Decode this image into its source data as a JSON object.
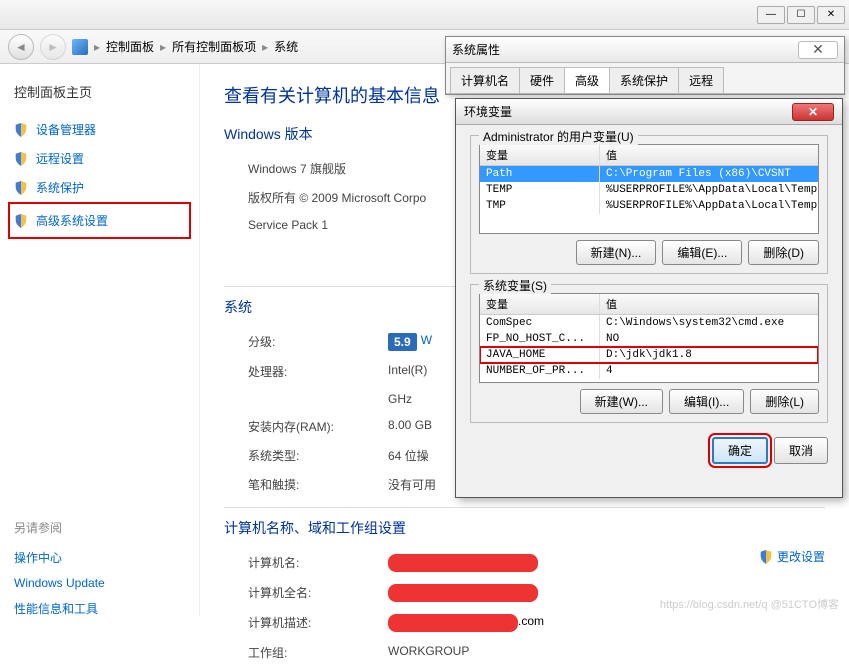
{
  "window": {
    "min": "—",
    "max": "☐",
    "close": "✕"
  },
  "breadcrumb": {
    "icon": "control-panel",
    "seg1": "控制面板",
    "seg2": "所有控制面板项",
    "seg3": "系统"
  },
  "sidebar": {
    "title": "控制面板主页",
    "items": [
      {
        "label": "设备管理器"
      },
      {
        "label": "远程设置"
      },
      {
        "label": "系统保护"
      },
      {
        "label": "高级系统设置"
      }
    ],
    "footer_title": "另请参阅",
    "footer_links": [
      "操作中心",
      "Windows Update",
      "性能信息和工具"
    ]
  },
  "content": {
    "title": "查看有关计算机的基本信息",
    "edition_title": "Windows 版本",
    "edition": "Windows 7 旗舰版",
    "copyright": "版权所有 © 2009 Microsoft Corpo",
    "sp": "Service Pack 1",
    "system_title": "系统",
    "rating_label": "分级:",
    "rating_value": "5.9",
    "rating_link": "W",
    "cpu_label": "处理器:",
    "cpu_value": "Intel(R)",
    "cpu_ghz": "GHz",
    "ram_label": "安装内存(RAM):",
    "ram_value": "8.00 GB",
    "type_label": "系统类型:",
    "type_value": "64 位操",
    "pen_label": "笔和触摸:",
    "pen_value": "没有可用",
    "comp_title": "计算机名称、域和工作组设置",
    "name_label": "计算机名:",
    "fullname_label": "计算机全名:",
    "desc_label": "计算机描述:",
    "desc_value": ".com",
    "workgroup_label": "工作组:",
    "workgroup_value": "WORKGROUP",
    "change_link": "更改设置"
  },
  "sysprops": {
    "title": "系统属性",
    "tabs": [
      "计算机名",
      "硬件",
      "高级",
      "系统保护",
      "远程"
    ]
  },
  "env": {
    "title": "环境变量",
    "user_label": "Administrator 的用户变量(U)",
    "col1": "变量",
    "col2": "值",
    "user_vars": [
      {
        "name": "Path",
        "value": "C:\\Program Files (x86)\\CVSNT"
      },
      {
        "name": "TEMP",
        "value": "%USERPROFILE%\\AppData\\Local\\Temp"
      },
      {
        "name": "TMP",
        "value": "%USERPROFILE%\\AppData\\Local\\Temp"
      }
    ],
    "sys_label": "系统变量(S)",
    "sys_vars": [
      {
        "name": "ComSpec",
        "value": "C:\\Windows\\system32\\cmd.exe"
      },
      {
        "name": "FP_NO_HOST_C...",
        "value": "NO"
      },
      {
        "name": "JAVA_HOME",
        "value": "D:\\jdk\\jdk1.8"
      },
      {
        "name": "NUMBER_OF_PR...",
        "value": "4"
      }
    ],
    "btn_new_u": "新建(N)...",
    "btn_edit_u": "编辑(E)...",
    "btn_del_u": "删除(D)",
    "btn_new_s": "新建(W)...",
    "btn_edit_s": "编辑(I)...",
    "btn_del_s": "删除(L)",
    "btn_ok": "确定",
    "btn_cancel": "取消"
  },
  "watermark": "https://blog.csdn.net/q   @51CTO博客"
}
